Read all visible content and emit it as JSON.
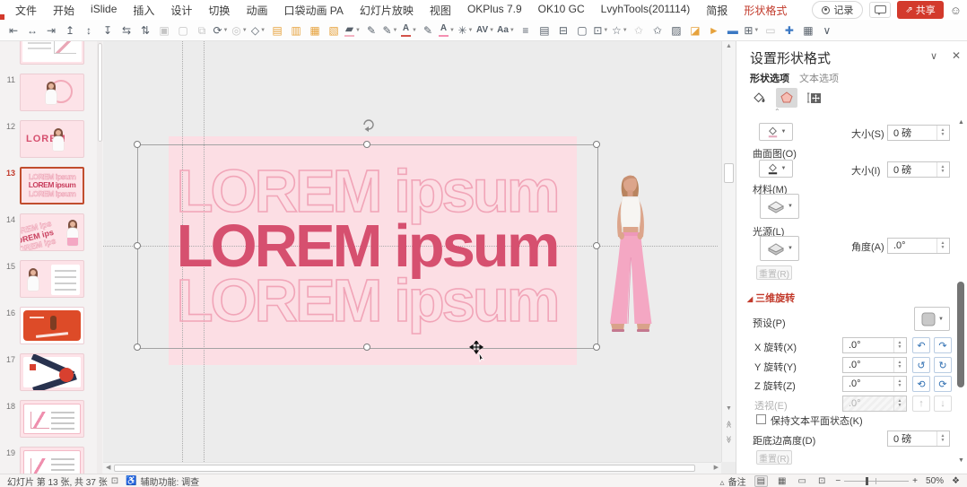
{
  "menubar": {
    "items": [
      {
        "label": "文件"
      },
      {
        "label": "开始"
      },
      {
        "label": "iSlide"
      },
      {
        "label": "插入"
      },
      {
        "label": "设计"
      },
      {
        "label": "切换"
      },
      {
        "label": "动画"
      },
      {
        "label": "口袋动画 PA"
      },
      {
        "label": "幻灯片放映"
      },
      {
        "label": "视图"
      },
      {
        "label": "OKPlus 7.9"
      },
      {
        "label": "OK10 GC"
      },
      {
        "label": "LvyhTools(201114)"
      },
      {
        "label": "简报"
      },
      {
        "label": "形状格式",
        "active": true
      }
    ],
    "record_label": "记录",
    "share_label": "共享"
  },
  "toolbar": {
    "icons": [
      {
        "n": "align-objects-left",
        "g": "⇤"
      },
      {
        "n": "align-objects-center",
        "g": "↔"
      },
      {
        "n": "align-objects-right",
        "g": "⇥"
      },
      {
        "n": "align-objects-top",
        "g": "↥"
      },
      {
        "n": "align-objects-middle",
        "g": "↕"
      },
      {
        "n": "align-objects-bottom",
        "g": "↧"
      },
      {
        "n": "distribute-horizontally",
        "g": "⇆"
      },
      {
        "n": "distribute-vertically",
        "g": "⇅"
      },
      {
        "n": "group",
        "g": "▣",
        "cls": "dis"
      },
      {
        "n": "ungroup",
        "g": "▢",
        "cls": "dis"
      },
      {
        "n": "regroup",
        "g": "⧉",
        "cls": "dis"
      },
      {
        "n": "rotate-objects",
        "g": "⟳",
        "caret": true
      },
      {
        "n": "merge-shapes",
        "g": "◎",
        "caret": true,
        "cls": "dis"
      },
      {
        "n": "edit-shape",
        "g": "◇",
        "caret": true
      },
      {
        "n": "bring-to-front",
        "g": "▤",
        "cls": "org"
      },
      {
        "n": "send-to-back",
        "g": "▥",
        "cls": "org"
      },
      {
        "n": "bring-forward",
        "g": "▦",
        "cls": "org"
      },
      {
        "n": "send-backward",
        "g": "▧",
        "cls": "org"
      },
      {
        "n": "shape-fill",
        "g": "▰",
        "caret": true,
        "bar": "#f3b3c3"
      },
      {
        "n": "eyedropper",
        "g": "✎"
      },
      {
        "n": "shape-outline",
        "g": "✎",
        "caret": true
      },
      {
        "n": "font-color",
        "t": "A",
        "caret": true,
        "bar": "#d35249"
      },
      {
        "n": "format-painter",
        "g": "✎"
      },
      {
        "n": "text-highlight",
        "t": "A",
        "caret": true,
        "bar": "#f48fb1"
      },
      {
        "n": "text-effects",
        "g": "✳",
        "caret": true
      },
      {
        "n": "character-spacing",
        "t": "AV",
        "caret": true
      },
      {
        "n": "change-case",
        "t": "Aa",
        "caret": true
      },
      {
        "n": "line-spacing",
        "g": "≡"
      },
      {
        "n": "text-columns",
        "g": "▤"
      },
      {
        "n": "smart-align",
        "g": "⊟"
      },
      {
        "n": "crop",
        "g": "▢"
      },
      {
        "n": "picture-border",
        "g": "⊡",
        "caret": true
      },
      {
        "n": "insert-icons",
        "g": "☆",
        "caret": true
      },
      {
        "n": "star-tool",
        "g": "✩",
        "cls": "dis"
      },
      {
        "n": "star-outline",
        "g": "✩"
      },
      {
        "n": "screenshot",
        "g": "▨"
      },
      {
        "n": "format-background",
        "g": "◪",
        "cls": "org"
      },
      {
        "n": "selection-tool",
        "g": "►",
        "cls": "org"
      },
      {
        "n": "text-box",
        "g": "▬",
        "cls": "blu"
      },
      {
        "n": "slide-layout",
        "g": "⊞",
        "caret": true
      },
      {
        "n": "placeholder",
        "g": "▭",
        "cls": "dis"
      },
      {
        "n": "move-tool",
        "g": "✚",
        "cls": "blu"
      },
      {
        "n": "insert-picture",
        "g": "▦"
      },
      {
        "n": "more-tools",
        "g": "∨"
      }
    ]
  },
  "thumbnails": {
    "lorem_word": "LOREM",
    "lorem_line": "LOREM ipsum",
    "diag_line": "OREM ips",
    "items": [
      {
        "num": "",
        "variant": "mini-ui"
      },
      {
        "num": "11",
        "variant": "woman-circle"
      },
      {
        "num": "12",
        "variant": "lorem-woman"
      },
      {
        "num": "13",
        "variant": "lorem-stack",
        "selected": true
      },
      {
        "num": "14",
        "variant": "diagonal"
      },
      {
        "num": "15",
        "variant": "woman-list"
      },
      {
        "num": "16",
        "variant": "orange"
      },
      {
        "num": "17",
        "variant": "ribbons"
      },
      {
        "num": "18",
        "variant": "chart-table"
      },
      {
        "num": "19",
        "variant": "chart-table"
      }
    ]
  },
  "canvas": {
    "text": "LOREM ipsum"
  },
  "panel": {
    "title": "设置形状格式",
    "tab_shape": "形状选项",
    "tab_text": "文本选项",
    "size_s_label": "大小(S)",
    "size_s_value": "0 磅",
    "contour_label": "曲面图(O)",
    "size_i_label": "大小(I)",
    "size_i_value": "0 磅",
    "material_label": "材料(M)",
    "lighting_label": "光源(L)",
    "angle_label": "角度(A)",
    "angle_value": ".0°",
    "reset1_label": "重置(R)",
    "rotation_section": "三维旋转",
    "preset_label": "预设(P)",
    "rx_label": "X 旋转(X)",
    "rx_value": ".0°",
    "ry_label": "Y 旋转(Y)",
    "ry_value": ".0°",
    "rz_label": "Z 旋转(Z)",
    "rz_value": ".0°",
    "persp_label": "透视(E)",
    "persp_value": ".0°",
    "keep_flat_label": "保持文本平面状态(K)",
    "height_label": "距底边高度(D)",
    "height_value": "0 磅",
    "reset2_label": "重置(R)"
  },
  "statusbar": {
    "slide_info": "幻灯片 第 13 张, 共 37 张",
    "accessibility": "辅助功能: 调查",
    "notes_label": "备注",
    "zoom_value": "50%"
  },
  "colors": {
    "accent": "#d33a2c",
    "solid_text": "#d6506f",
    "outline_text": "#f1a5b8",
    "page_pink": "#fcdee4"
  }
}
